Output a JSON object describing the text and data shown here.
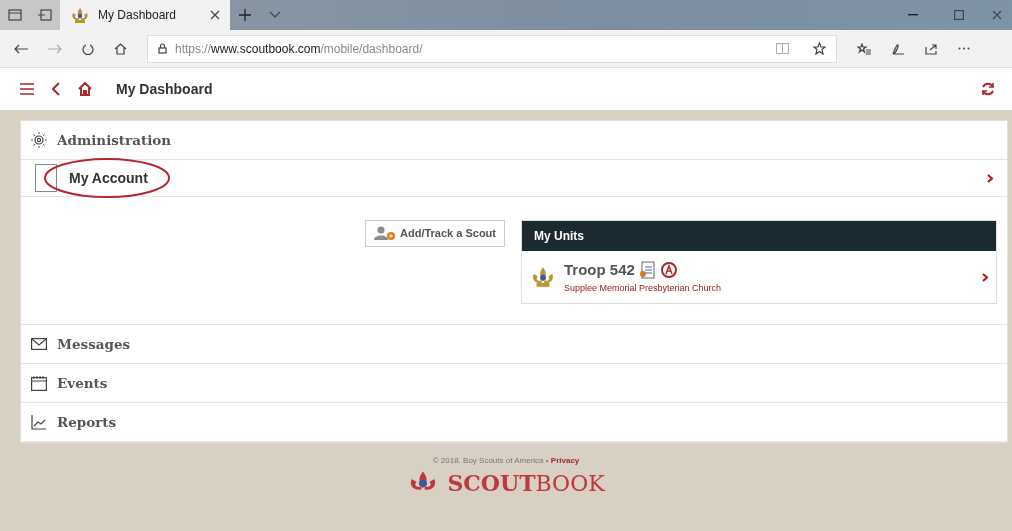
{
  "browser": {
    "tab_title": "My Dashboard",
    "url": "https://**www.scoutbook.com**/mobile/dashboard/"
  },
  "app_header": {
    "title": "My Dashboard"
  },
  "sections": [
    {
      "kind": "gear",
      "label": "Administration",
      "items": [
        {
          "label": "My Account",
          "highlighted": true
        }
      ]
    },
    {
      "kind": "envelope",
      "label": "Messages"
    },
    {
      "kind": "calendar",
      "label": "Events"
    },
    {
      "kind": "chart",
      "label": "Reports"
    }
  ],
  "add_button": "Add/Track a Scout",
  "units_panel": {
    "title": "My Units",
    "units": [
      {
        "name": "Troop 542",
        "organization": "Supplee Memorial Presbyterian Church"
      }
    ]
  },
  "footer": {
    "copyright": "© 2018. Boy Scouts of America •",
    "link": "Privacy",
    "logo": "**SCOUT**BOOK"
  }
}
